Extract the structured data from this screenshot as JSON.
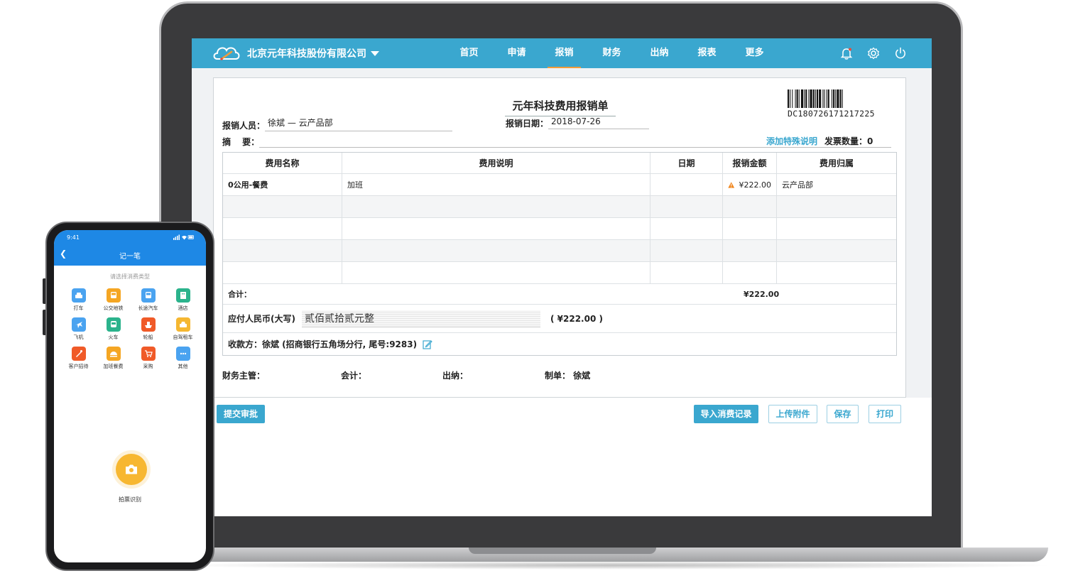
{
  "app": {
    "company": "北京元年科技股份有限公司",
    "nav": [
      "首页",
      "申请",
      "报销",
      "财务",
      "出纳",
      "报表",
      "更多"
    ],
    "active_nav_index": 2,
    "icons": [
      "bell-icon",
      "gear-icon",
      "power-icon"
    ],
    "accent_color": "#3aa7cf",
    "active_underline_color": "#f39c3a"
  },
  "form": {
    "title": "元年科技费用报销单",
    "barcode_number": "DC180726171217225",
    "person_label": "报销人员：",
    "person_value": "徐斌 — 云产品部",
    "date_label": "报销日期：",
    "date_value": "2018-07-26",
    "summary_label": "摘　 要：",
    "summary_value": "",
    "special_link": "添加特殊说明",
    "invoice_count": "发票数量：0",
    "table": {
      "headers": [
        "费用名称",
        "费用说明",
        "日期",
        "报销金额",
        "费用归属"
      ],
      "rows": [
        {
          "name": "0公用-餐费",
          "desc": "加班",
          "date": "",
          "amount": "¥222.00",
          "belong": "云产品部",
          "warning": true
        }
      ],
      "empty_rows": 4,
      "total_label": "合计：",
      "total_value": "¥222.00"
    },
    "rmb_label": "应付人民币(大写)",
    "rmb_value": "贰佰贰拾贰元整",
    "rmb_paren": "( ¥222.00 )",
    "payee": "收款方：徐斌 (招商银行五角场分行, 尾号:9283)",
    "signatures": {
      "manager": "财务主管：",
      "accountant": "会计：",
      "cashier": "出纳：",
      "maker": "制单：  徐斌"
    }
  },
  "buttons": {
    "submit": "提交审批",
    "import": "导入消费记录",
    "upload": "上传附件",
    "save": "保存",
    "print": "打印"
  },
  "phone": {
    "time": "9:41",
    "title": "记一笔",
    "subtitle": "请选择消费类型",
    "categories": [
      {
        "label": "打车",
        "icon": "taxi-icon",
        "color": "#4aa3f0"
      },
      {
        "label": "公交地铁",
        "icon": "bus-icon",
        "color": "#f5a623"
      },
      {
        "label": "长途汽车",
        "icon": "coach-icon",
        "color": "#4aa3f0"
      },
      {
        "label": "酒店",
        "icon": "hotel-icon",
        "color": "#2bb38c"
      },
      {
        "label": "飞机",
        "icon": "plane-icon",
        "color": "#4aa3f0"
      },
      {
        "label": "火车",
        "icon": "train-icon",
        "color": "#2bb38c"
      },
      {
        "label": "轮船",
        "icon": "ship-icon",
        "color": "#f05a28"
      },
      {
        "label": "自驾租车",
        "icon": "car-icon",
        "color": "#f5b731"
      },
      {
        "label": "客户招待",
        "icon": "reception-icon",
        "color": "#f05a28"
      },
      {
        "label": "加班餐费",
        "icon": "meal-icon",
        "color": "#f5a623"
      },
      {
        "label": "采购",
        "icon": "cart-icon",
        "color": "#f05a28"
      },
      {
        "label": "其他",
        "icon": "more-icon",
        "color": "#4aa3f0"
      }
    ],
    "camera_label": "拍票识别",
    "header_color": "#1e88e5"
  }
}
